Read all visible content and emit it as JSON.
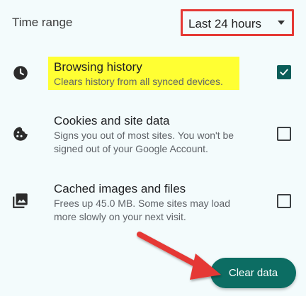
{
  "time_range": {
    "label": "Time range",
    "selected": "Last 24 hours"
  },
  "items": [
    {
      "title": "Browsing history",
      "description_lines": [
        "Clears history from all synced devices."
      ],
      "checked": true,
      "icon": "clock-icon"
    },
    {
      "title": "Cookies and site data",
      "description_lines": [
        "Signs you out of most sites. You won't be",
        "signed out of your Google Account."
      ],
      "checked": false,
      "icon": "cookie-icon"
    },
    {
      "title": "Cached images and files",
      "description_lines": [
        "Frees up 45.0 MB. Some sites may load",
        "more slowly on your next visit."
      ],
      "checked": false,
      "icon": "image-icon"
    }
  ],
  "clear_button": {
    "label": "Clear data"
  },
  "colors": {
    "accent": "#0c6d63",
    "highlight": "#ffff33",
    "annotation": "#e53935"
  }
}
